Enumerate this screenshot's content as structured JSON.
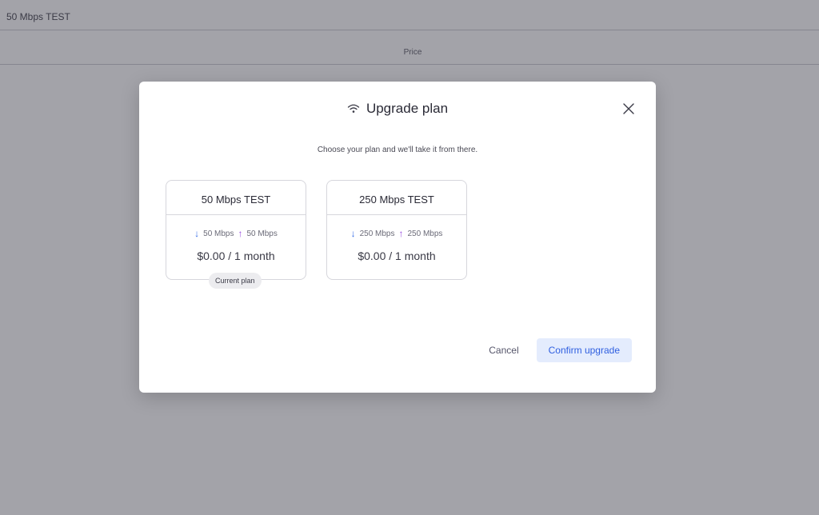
{
  "background": {
    "plan_title": "50 Mbps TEST",
    "price_label": "Price"
  },
  "modal": {
    "title": "Upgrade plan",
    "subtitle": "Choose your plan and we'll take it from there.",
    "title_icon": "wifi-icon",
    "close_icon": "close-icon",
    "plans": [
      {
        "name": "50 Mbps TEST",
        "download": "50 Mbps",
        "upload": "50 Mbps",
        "price": "$0.00 / 1 month",
        "badge": "Current plan"
      },
      {
        "name": "250 Mbps TEST",
        "download": "250 Mbps",
        "upload": "250 Mbps",
        "price": "$0.00 / 1 month"
      }
    ],
    "cancel_label": "Cancel",
    "confirm_label": "Confirm upgrade"
  },
  "colors": {
    "accent": "#2f5fe0",
    "accent_bg": "#e4ecfd",
    "download_arrow": "#3a6fe8",
    "upload_arrow": "#9a4fe0"
  }
}
